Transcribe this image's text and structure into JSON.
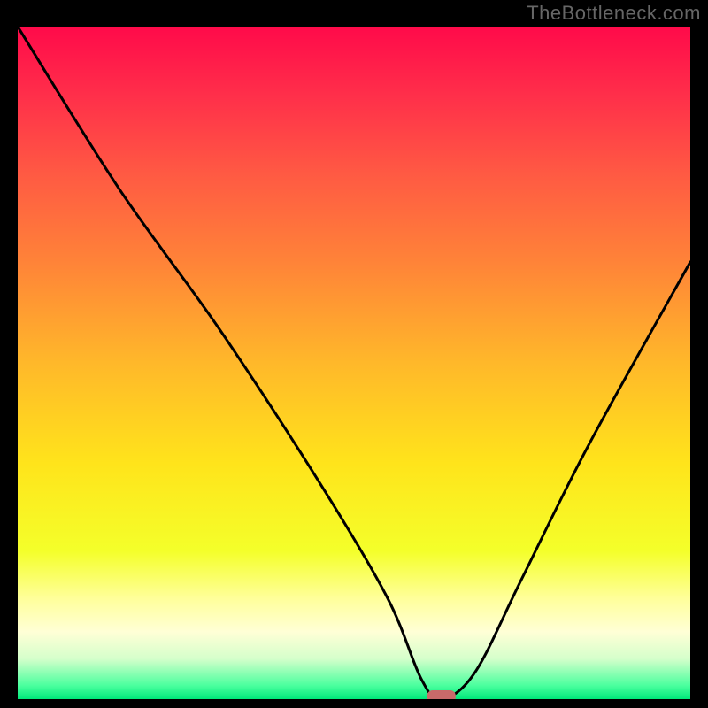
{
  "watermark": "TheBottleneck.com",
  "chart_data": {
    "type": "line",
    "title": "",
    "xlabel": "",
    "ylabel": "",
    "xlim": [
      0,
      100
    ],
    "ylim": [
      0,
      100
    ],
    "series": [
      {
        "name": "bottleneck-curve",
        "x": [
          0,
          15,
          30,
          45,
          55,
          60,
          63,
          68,
          75,
          85,
          100
        ],
        "values": [
          100,
          76,
          55,
          32,
          15,
          3,
          0,
          4,
          18,
          38,
          65
        ]
      }
    ],
    "marker": {
      "x": 63,
      "y": 0,
      "color": "#c96a6a"
    },
    "background_gradient": [
      {
        "stop": 0.0,
        "color": "#ff0a4a"
      },
      {
        "stop": 0.1,
        "color": "#ff2e4a"
      },
      {
        "stop": 0.22,
        "color": "#ff5a43"
      },
      {
        "stop": 0.35,
        "color": "#ff8338"
      },
      {
        "stop": 0.5,
        "color": "#ffb82a"
      },
      {
        "stop": 0.65,
        "color": "#ffe41b"
      },
      {
        "stop": 0.78,
        "color": "#f4ff2a"
      },
      {
        "stop": 0.85,
        "color": "#ffff9a"
      },
      {
        "stop": 0.9,
        "color": "#ffffd6"
      },
      {
        "stop": 0.94,
        "color": "#d5ffcb"
      },
      {
        "stop": 0.98,
        "color": "#4aff9e"
      },
      {
        "stop": 1.0,
        "color": "#00e87a"
      }
    ]
  }
}
